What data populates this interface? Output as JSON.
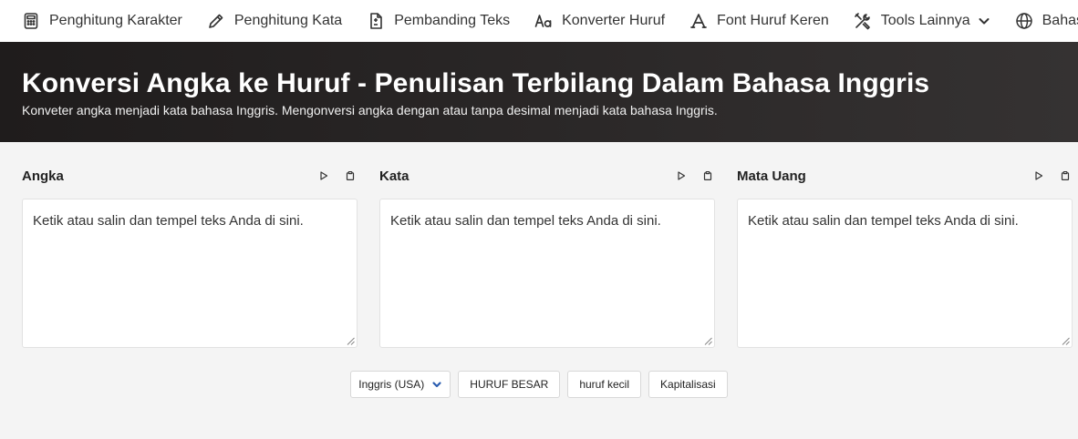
{
  "nav": {
    "items": [
      {
        "label": "Penghitung Karakter",
        "icon": "calculator-icon"
      },
      {
        "label": "Penghitung Kata",
        "icon": "pencil-icon"
      },
      {
        "label": "Pembanding Teks",
        "icon": "file-diff-icon"
      },
      {
        "label": "Konverter Huruf",
        "icon": "text-case-icon"
      },
      {
        "label": "Font Huruf Keren",
        "icon": "font-icon"
      },
      {
        "label": "Tools Lainnya",
        "icon": "tools-icon"
      },
      {
        "label": "Bahasa",
        "icon": "globe-icon"
      }
    ]
  },
  "hero": {
    "title": "Konversi Angka ke Huruf - Penulisan Terbilang Dalam Bahasa Inggris",
    "subtitle": "Konveter angka menjadi kata bahasa Inggris. Mengonversi angka dengan atau tanpa desimal menjadi kata bahasa Inggris."
  },
  "panels": [
    {
      "title": "Angka",
      "placeholder": "Ketik atau salin dan tempel teks Anda di sini."
    },
    {
      "title": "Kata",
      "placeholder": "Ketik atau salin dan tempel teks Anda di sini."
    },
    {
      "title": "Mata Uang",
      "placeholder": "Ketik atau salin dan tempel teks Anda di sini."
    }
  ],
  "actions": {
    "language_selected": "Inggris (USA)",
    "uppercase_label": "HURUF BESAR",
    "lowercase_label": "huruf kecil",
    "capitalize_label": "Kapitalisasi"
  },
  "colors": {
    "hero_bg": "#2b2828",
    "page_bg": "#f4f4f4",
    "accent": "#2a5db0"
  }
}
